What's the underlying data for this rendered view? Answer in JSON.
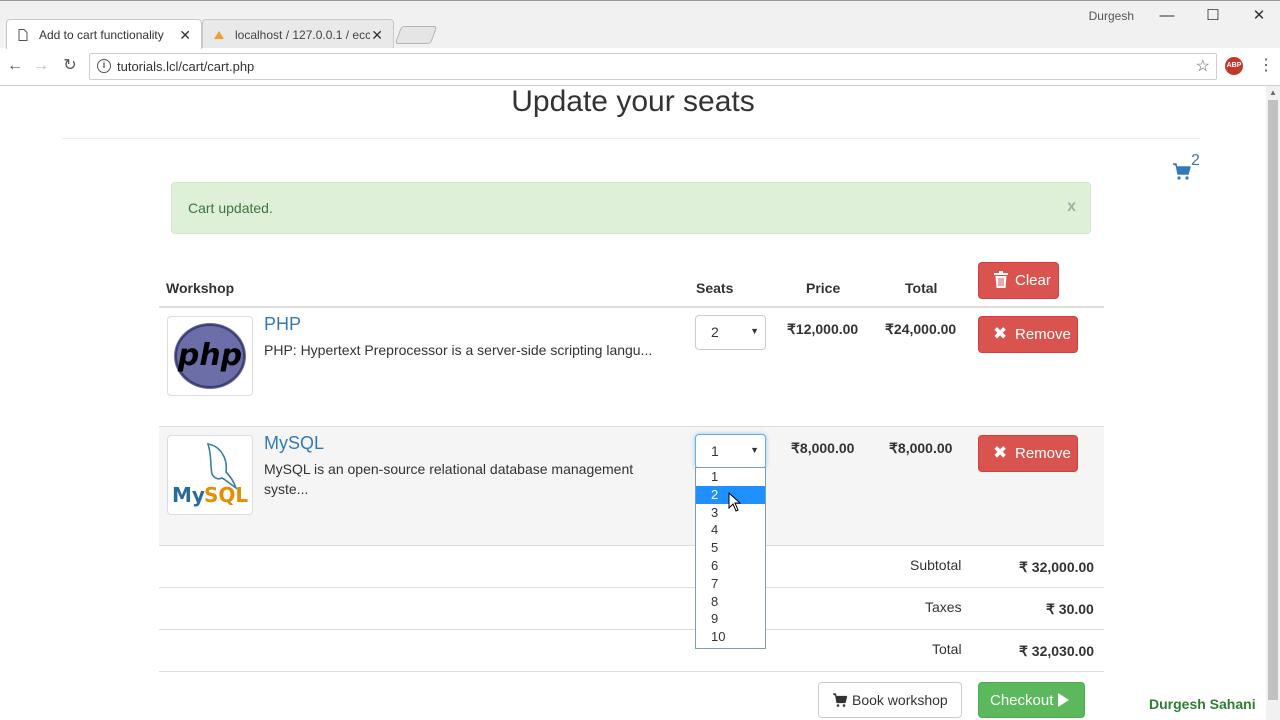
{
  "browser": {
    "tabs": [
      {
        "title": "Add to cart functionality",
        "active": true
      },
      {
        "title": "localhost / 127.0.0.1 / ecc",
        "active": false
      }
    ],
    "user": "Durgesh",
    "url": "tutorials.lcl/cart/cart.php",
    "window_controls": {
      "minimize": "—",
      "maximize": "☐",
      "close": "✕"
    },
    "abp_label": "ABP"
  },
  "page": {
    "heading": "Update your seats",
    "cart_count": "2",
    "alert": {
      "message": "Cart updated.",
      "close": "x"
    },
    "table": {
      "headers": {
        "workshop": "Workshop",
        "seats": "Seats",
        "price": "Price",
        "total": "Total"
      },
      "clear_label": "Clear",
      "rows": [
        {
          "title": "PHP",
          "desc": "PHP: Hypertext Preprocessor is a server-side scripting langu...",
          "seats": "2",
          "price": "₹12,000.00",
          "total": "₹24,000.00",
          "remove_label": "Remove",
          "logo": "php-logo"
        },
        {
          "title": "MySQL",
          "desc": "MySQL is an open-source relational database management syste...",
          "seats": "1",
          "price": "₹8,000.00",
          "total": "₹8,000.00",
          "remove_label": "Remove",
          "logo": "mysql-logo"
        }
      ]
    },
    "summary": {
      "subtotal_label": "Subtotal",
      "subtotal": "₹ 32,000.00",
      "taxes_label": "Taxes",
      "taxes": "₹ 30.00",
      "total_label": "Total",
      "total": "₹ 32,030.00"
    },
    "seat_options": [
      "1",
      "2",
      "3",
      "4",
      "5",
      "6",
      "7",
      "8",
      "9",
      "10"
    ],
    "seat_highlighted": "2",
    "book_label": "Book workshop",
    "checkout_label": "Checkout",
    "brand": "Durgesh Sahani",
    "colors": {
      "link": "#337ab7",
      "danger": "#d9534f",
      "success": "#5cb85c",
      "alert_bg": "#dff0d8"
    }
  }
}
